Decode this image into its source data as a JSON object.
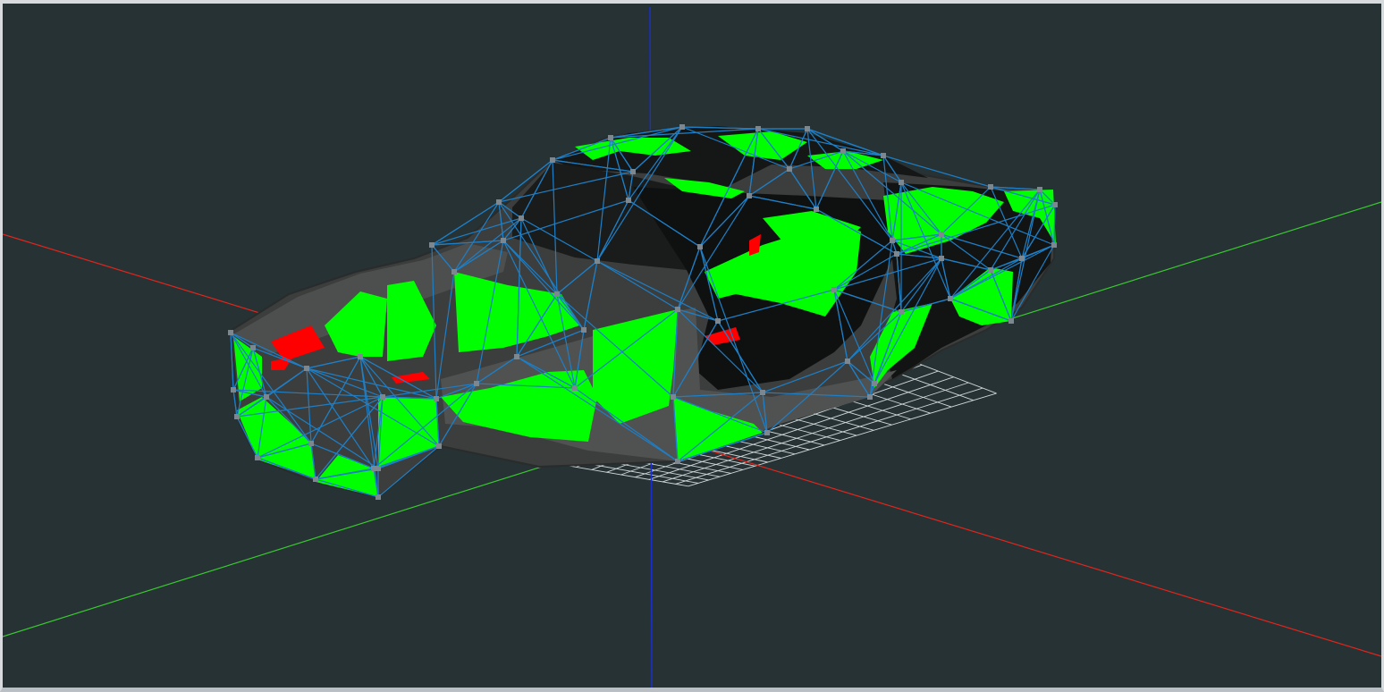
{
  "app": {
    "view": "3d-viewport"
  },
  "scene": {
    "background_color": "#263234",
    "grid_color": "#cfd6d8",
    "axis_colors": {
      "x": "#e2251d",
      "y": "#38c92f",
      "z": "#1a2fd0"
    },
    "model": {
      "name": "",
      "body_color": "#3e3e3e",
      "dark_color": "#111313",
      "highlight_color": "#00ff00",
      "alert_color": "#ff0000",
      "wireframe_color": "#1e7fc6",
      "vertex_color": "#7d8790"
    }
  }
}
